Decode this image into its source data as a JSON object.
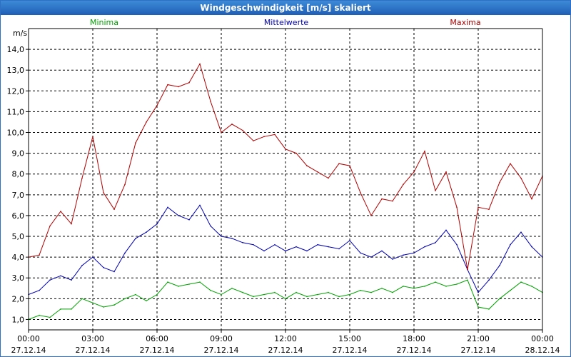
{
  "window": {
    "title": "Windgeschwindigkeit [m/s] skaliert"
  },
  "chart_data": {
    "type": "line",
    "ylabel": "m/s",
    "ylim": [
      0.5,
      15.0
    ],
    "xlim": [
      "2014-12-27 00:00",
      "2014-12-28 00:00"
    ],
    "grid": true,
    "legend": "top",
    "y_ticks": [
      "1,0",
      "2,0",
      "3,0",
      "4,0",
      "5,0",
      "6,0",
      "7,0",
      "8,0",
      "9,0",
      "10,0",
      "11,0",
      "12,0",
      "13,0",
      "14,0"
    ],
    "x_ticks": [
      {
        "time": "00:00",
        "date": "27.12.14"
      },
      {
        "time": "03:00",
        "date": "27.12.14"
      },
      {
        "time": "06:00",
        "date": "27.12.14"
      },
      {
        "time": "09:00",
        "date": "27.12.14"
      },
      {
        "time": "12:00",
        "date": "27.12.14"
      },
      {
        "time": "15:00",
        "date": "27.12.14"
      },
      {
        "time": "18:00",
        "date": "27.12.14"
      },
      {
        "time": "21:00",
        "date": "27.12.14"
      },
      {
        "time": "00:00",
        "date": "28.12.14"
      }
    ],
    "x_hours": [
      0,
      0.5,
      1,
      1.5,
      2,
      2.5,
      3,
      3.5,
      4,
      4.5,
      5,
      5.5,
      6,
      6.5,
      7,
      7.5,
      8,
      8.5,
      9,
      9.5,
      10,
      10.5,
      11,
      11.5,
      12,
      12.5,
      13,
      13.5,
      14,
      14.5,
      15,
      15.5,
      16,
      16.5,
      17,
      17.5,
      18,
      18.5,
      19,
      19.5,
      20,
      20.5,
      21,
      21.5,
      22,
      22.5,
      23,
      23.5,
      24
    ],
    "series": [
      {
        "name": "Minima",
        "color": "#00a000",
        "values": [
          1.0,
          1.2,
          1.1,
          1.5,
          1.5,
          2.0,
          1.8,
          1.6,
          1.7,
          2.0,
          2.2,
          1.9,
          2.2,
          2.8,
          2.6,
          2.7,
          2.8,
          2.4,
          2.2,
          2.5,
          2.3,
          2.1,
          2.2,
          2.3,
          2.0,
          2.3,
          2.1,
          2.2,
          2.3,
          2.1,
          2.2,
          2.4,
          2.3,
          2.5,
          2.3,
          2.6,
          2.5,
          2.6,
          2.8,
          2.6,
          2.7,
          2.9,
          1.6,
          1.5,
          2.0,
          2.4,
          2.8,
          2.6,
          2.3
        ]
      },
      {
        "name": "Mittelwerte",
        "color": "#0000b0",
        "values": [
          2.2,
          2.4,
          2.9,
          3.1,
          2.9,
          3.6,
          4.0,
          3.5,
          3.3,
          4.2,
          4.9,
          5.2,
          5.6,
          6.4,
          6.0,
          5.8,
          6.5,
          5.5,
          5.0,
          4.9,
          4.7,
          4.6,
          4.3,
          4.6,
          4.3,
          4.5,
          4.3,
          4.6,
          4.5,
          4.4,
          4.8,
          4.2,
          4.0,
          4.3,
          3.9,
          4.1,
          4.2,
          4.5,
          4.7,
          5.3,
          4.6,
          3.4,
          2.3,
          2.9,
          3.6,
          4.6,
          5.2,
          4.5,
          4.0
        ]
      },
      {
        "name": "Maxima",
        "color": "#b00000",
        "values": [
          4.0,
          4.1,
          5.5,
          6.2,
          5.6,
          7.8,
          9.8,
          7.1,
          6.3,
          7.5,
          9.5,
          10.5,
          11.3,
          12.3,
          12.2,
          12.4,
          13.3,
          11.5,
          10.0,
          10.4,
          10.1,
          9.6,
          9.8,
          9.9,
          9.2,
          9.0,
          8.4,
          8.1,
          7.8,
          8.5,
          8.4,
          7.1,
          6.0,
          6.8,
          6.7,
          7.5,
          8.1,
          9.1,
          7.2,
          8.1,
          6.4,
          3.4,
          6.4,
          6.3,
          7.6,
          8.5,
          7.8,
          6.8,
          7.9
        ]
      }
    ]
  }
}
